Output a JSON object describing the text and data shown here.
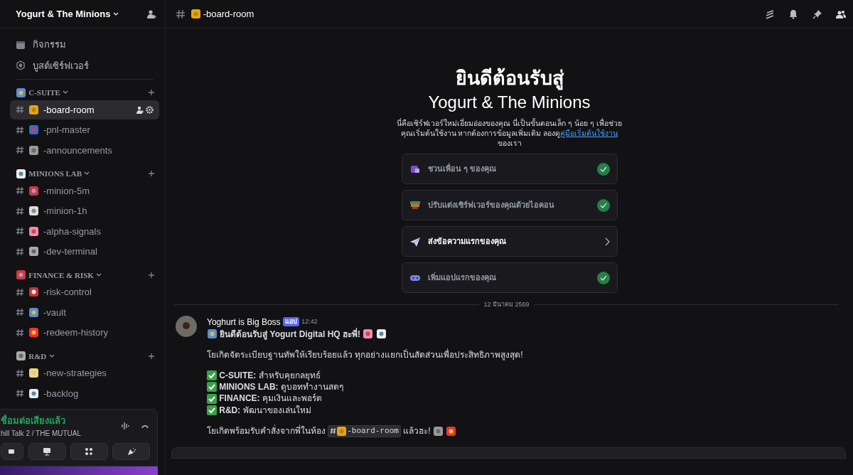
{
  "server": {
    "name": "Yogurt & The Minions"
  },
  "sidebar_items": [
    {
      "label": "กิจกรรม",
      "kind": "calendar"
    },
    {
      "label": "บูสต์เซิร์ฟเวอร์",
      "kind": "boost"
    }
  ],
  "categories": [
    {
      "name": "C-SUITE",
      "channels": [
        {
          "name": "-board-room",
          "selected": true
        },
        {
          "name": "-pnl-master",
          "selected": false
        },
        {
          "name": "-announcements",
          "selected": false
        }
      ]
    },
    {
      "name": "MINIONS LAB",
      "channels": [
        {
          "name": "-minion-5m",
          "selected": false
        },
        {
          "name": "-minion-1h",
          "selected": false
        },
        {
          "name": "-alpha-signals",
          "selected": false
        },
        {
          "name": "-dev-terminal",
          "selected": false
        }
      ]
    },
    {
      "name": "FINANCE & RISK",
      "channels": [
        {
          "name": "-risk-control",
          "selected": false
        },
        {
          "name": "-vault",
          "selected": false
        },
        {
          "name": "-redeem-history",
          "selected": false
        }
      ]
    },
    {
      "name": "R&D",
      "channels": [
        {
          "name": "-new-strategies",
          "selected": false
        },
        {
          "name": "-backlog",
          "selected": false
        }
      ]
    }
  ],
  "voice": {
    "status": "ชื่อมต่อเสียงแล้ว",
    "channel": "hill Talk 2 / THE MUTUAL"
  },
  "header": {
    "channel": "-board-room"
  },
  "welcome": {
    "title": "ยินดีต้อนรับสู่",
    "server": "Yogurt & The Minions",
    "text": "นี่คือเซิร์ฟเวอร์ใหม่เอี่ยมอ่องของคุณ นี่เป็นขั้นตอนเล็ก ๆ น้อย ๆ เพื่อช่วยคุณเริ่มต้นใช้งาน หากต้องการข้อมูลเพิ่มเติม ลองดู",
    "link": "คู่มือเริ่มต้นใช้งาน",
    "text_after": "ของเรา"
  },
  "tasks": [
    {
      "label": "ชวนเพื่อน ๆ ของคุณ",
      "checked": true
    },
    {
      "label": "ปรับแต่งเซิร์ฟเวอร์ของคุณด้วยไอคอน",
      "checked": true
    },
    {
      "label": "ส่งข้อความแรกของคุณ",
      "checked": false
    },
    {
      "label": "เพิ่มแอปแรกของคุณ",
      "checked": true
    }
  ],
  "date_divider": "12 มีนาคม 2569",
  "message": {
    "author": "Yoghurt is Big Boss",
    "badge": "แอป",
    "time": "12:42",
    "title": "ยินดีต้อนรับสู่ Yogurt Digital HQ ฮะพี่!",
    "intro": "โยเกิดจัดระเบียบฐานทัพให้เรียบร้อยแล้ว ทุกอย่างแยกเป็นสัดส่วนเพื่อประสิทธิภาพสูงสุด!",
    "points": [
      "**C-SUITE:** สำหรับคุยกลยุทธ์",
      "**MINIONS LAB:** ดูบอททำงานสดๆ",
      "**FINANCE:** คุมเงินและพอร์ต",
      "**R&D:** พัฒนาของเล่นใหม่"
    ],
    "outro": "โยเกิดพร้อมรับคำสั่งจากพี่ในห้อง",
    "mention": "-board-room",
    "outro_after": "แล้วฮะ!"
  }
}
